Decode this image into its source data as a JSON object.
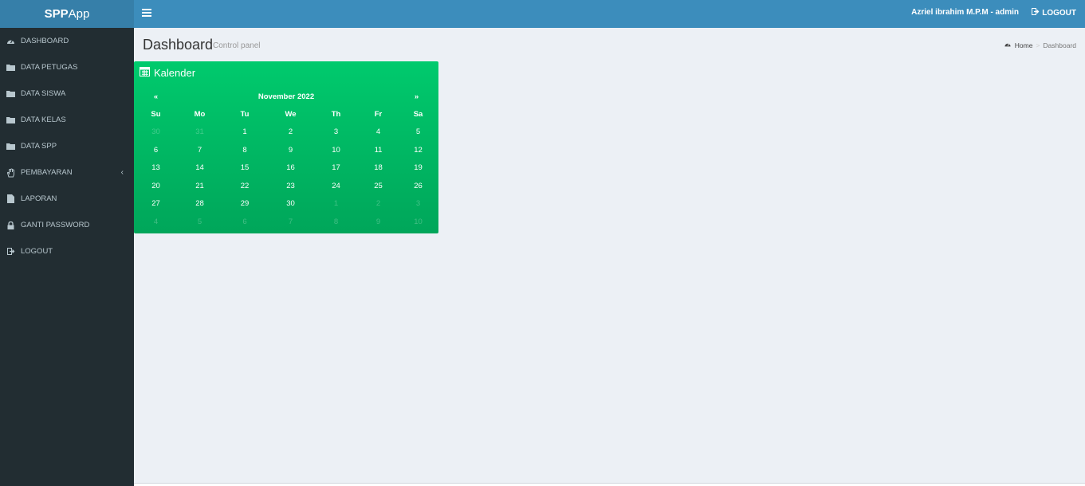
{
  "header": {
    "logo_bold": "SPP",
    "logo_rest": "App",
    "user_label": "Azriel ibrahim M.P.M - admin",
    "logout_label": "LOGOUT"
  },
  "sidebar": {
    "items": [
      {
        "label": "DASHBOARD",
        "icon": "dashboard-icon"
      },
      {
        "label": "DATA PETUGAS",
        "icon": "folder-icon"
      },
      {
        "label": "DATA SISWA",
        "icon": "folder-icon"
      },
      {
        "label": "DATA KELAS",
        "icon": "folder-icon"
      },
      {
        "label": "DATA SPP",
        "icon": "folder-icon"
      },
      {
        "label": "PEMBAYARAN",
        "icon": "hand-icon"
      },
      {
        "label": "LAPORAN",
        "icon": "file-icon"
      },
      {
        "label": "GANTI PASSWORD",
        "icon": "lock-icon"
      },
      {
        "label": "LOGOUT",
        "icon": "sign-out-icon"
      }
    ]
  },
  "content": {
    "title": "Dashboard",
    "subtitle": "Control panel",
    "breadcrumb": {
      "home": "Home",
      "current": "Dashboard"
    }
  },
  "calendar": {
    "title": "Kalender",
    "prev": "«",
    "next": "»",
    "month_label": "November 2022",
    "weekdays": [
      "Su",
      "Mo",
      "Tu",
      "We",
      "Th",
      "Fr",
      "Sa"
    ],
    "weeks": [
      [
        {
          "d": "30",
          "o": true
        },
        {
          "d": "31",
          "o": true
        },
        {
          "d": "1"
        },
        {
          "d": "2"
        },
        {
          "d": "3"
        },
        {
          "d": "4"
        },
        {
          "d": "5"
        }
      ],
      [
        {
          "d": "6"
        },
        {
          "d": "7"
        },
        {
          "d": "8"
        },
        {
          "d": "9"
        },
        {
          "d": "10"
        },
        {
          "d": "11"
        },
        {
          "d": "12"
        }
      ],
      [
        {
          "d": "13"
        },
        {
          "d": "14"
        },
        {
          "d": "15"
        },
        {
          "d": "16"
        },
        {
          "d": "17"
        },
        {
          "d": "18"
        },
        {
          "d": "19"
        }
      ],
      [
        {
          "d": "20"
        },
        {
          "d": "21"
        },
        {
          "d": "22"
        },
        {
          "d": "23"
        },
        {
          "d": "24"
        },
        {
          "d": "25"
        },
        {
          "d": "26"
        }
      ],
      [
        {
          "d": "27"
        },
        {
          "d": "28"
        },
        {
          "d": "29"
        },
        {
          "d": "30"
        },
        {
          "d": "1",
          "o": true
        },
        {
          "d": "2",
          "o": true
        },
        {
          "d": "3",
          "o": true
        }
      ],
      [
        {
          "d": "4",
          "o": true
        },
        {
          "d": "5",
          "o": true
        },
        {
          "d": "6",
          "o": true
        },
        {
          "d": "7",
          "o": true
        },
        {
          "d": "8",
          "o": true
        },
        {
          "d": "9",
          "o": true
        },
        {
          "d": "10",
          "o": true
        }
      ]
    ]
  },
  "colors": {
    "header": "#3c8dbc",
    "logo_bg": "#367fa9",
    "sidebar": "#222d32",
    "calendar": "#00a65a"
  }
}
